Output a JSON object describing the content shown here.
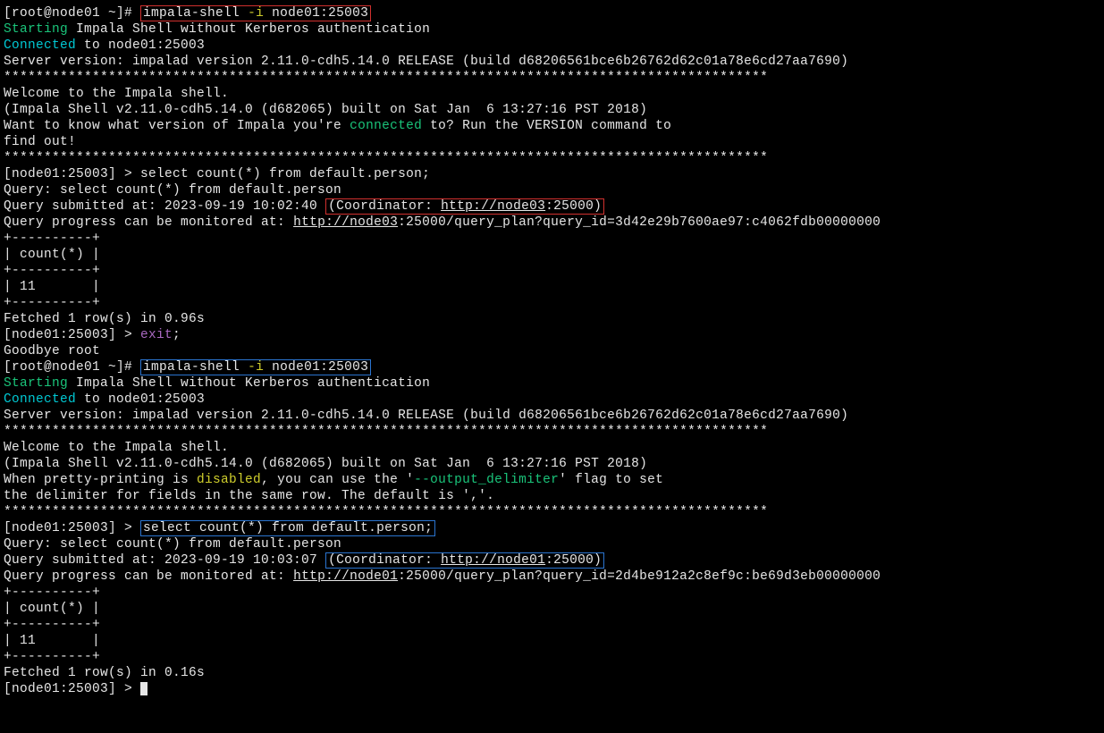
{
  "s1": {
    "prompt_pre": "[root@node01 ~]# ",
    "cmd_a": "impala-shell ",
    "cmd_flag": "-i",
    "cmd_b": " node01:25003",
    "starting": "Starting",
    "starting_rest": " Impala Shell without Kerberos authentication",
    "connected": "Connected",
    "connected_rest": " to node01:25003",
    "server_version": "Server version: impalad version 2.11.0-cdh5.14.0 RELEASE (build d68206561bce6b26762d62c01a78e6cd27aa7690)",
    "stars": "***********************************************************************************************",
    "welcome": "Welcome to the Impala shell.",
    "build": "(Impala Shell v2.11.0-cdh5.14.0 (d682065) built on Sat Jan  6 13:27:16 PST 2018)",
    "blank": "",
    "want_a": "Want to know what version of Impala you're ",
    "want_connected": "connected",
    "want_b": " to? Run the VERSION command to",
    "findout": "find out!",
    "sql_prompt": "[node01:25003] > select count(*) from default.person;",
    "query_echo": "Query: select count(*) from default.person",
    "submitted_a": "Query submitted at: 2023-09-19 10:02:40 ",
    "coord_a": "(Coordinator: ",
    "coord_url": "http://node03",
    "coord_b": ":25000)",
    "progress_a": "Query progress can be monitored at: ",
    "progress_url": "http://node03",
    "progress_b": ":25000/query_plan?query_id=3d42e29b7600ae97:c4062fdb00000000",
    "tbl_border": "+----------+",
    "tbl_header": "| count(*) |",
    "tbl_row": "| 11       |",
    "fetched": "Fetched 1 row(s) in 0.96s",
    "exit_prompt": "[node01:25003] > ",
    "exit_cmd": "exit",
    "exit_semi": ";",
    "goodbye": "Goodbye root"
  },
  "s2": {
    "prompt_pre": "[root@node01 ~]# ",
    "cmd_a": "impala-shell ",
    "cmd_flag": "-i",
    "cmd_b": " node01:25003",
    "starting": "Starting",
    "starting_rest": " Impala Shell without Kerberos authentication",
    "connected": "Connected",
    "connected_rest": " to node01:25003",
    "server_version": "Server version: impalad version 2.11.0-cdh5.14.0 RELEASE (build d68206561bce6b26762d62c01a78e6cd27aa7690)",
    "stars": "***********************************************************************************************",
    "welcome": "Welcome to the Impala shell.",
    "build": "(Impala Shell v2.11.0-cdh5.14.0 (d682065) built on Sat Jan  6 13:27:16 PST 2018)",
    "blank": "",
    "pretty_a": "When pretty-printing is ",
    "pretty_disabled": "disabled",
    "pretty_b": ", you can use the '",
    "pretty_flag": "--output_delimiter",
    "pretty_c": "' flag to set",
    "pretty_line2": "the delimiter for fields in the same row. The default is ','.",
    "sql_prompt_pre": "[node01:25003] > ",
    "sql_stmt": "select count(*) from default.person;",
    "query_echo": "Query: select count(*) from default.person",
    "submitted_a": "Query submitted at: 2023-09-19 10:03:07 ",
    "coord_a": "(Coordinator: ",
    "coord_url": "http://node01",
    "coord_b": ":25000)",
    "progress_a": "Query progress can be monitored at: ",
    "progress_url": "http://node01",
    "progress_b": ":25000/query_plan?query_id=2d4be912a2c8ef9c:be69d3eb00000000",
    "tbl_border": "+----------+",
    "tbl_header": "| count(*) |",
    "tbl_row": "| 11       |",
    "fetched": "Fetched 1 row(s) in 0.16s",
    "final_prompt": "[node01:25003] > "
  }
}
